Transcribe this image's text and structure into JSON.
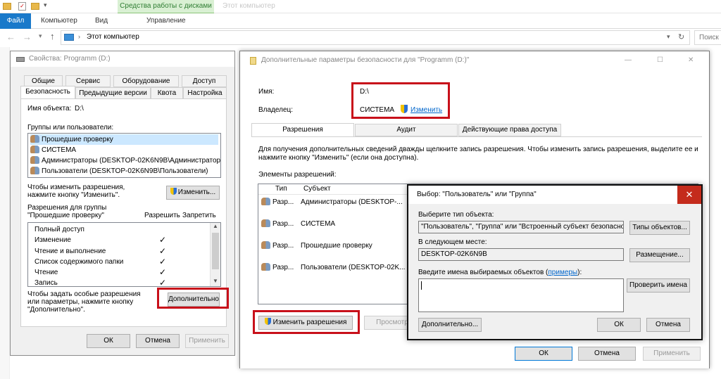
{
  "ribbon": {
    "tabs": [
      "Файл",
      "Компьютер",
      "Вид"
    ],
    "context_group": "Средства работы с дисками",
    "context_tab": "Управление",
    "faded_title": "Этот компьютер"
  },
  "address": {
    "path": "Этот компьютер",
    "search_placeholder": "Поиск"
  },
  "props": {
    "title": "Свойства: Programm (D:)",
    "tabs_row1": [
      "Общие",
      "Сервис",
      "Оборудование",
      "Доступ"
    ],
    "tabs_row2": [
      "Безопасность",
      "Предыдущие версии",
      "Квота",
      "Настройка"
    ],
    "object_label": "Имя объекта:",
    "object_value": "D:\\",
    "groups_label": "Группы или пользователи:",
    "groups": [
      "Прошедшие проверку",
      "СИСТЕМА",
      "Администраторы (DESKTOP-02K6N9B\\Администраторы)",
      "Пользователи (DESKTOP-02K6N9B\\Пользователи)"
    ],
    "change_hint": "Чтобы изменить разрешения, нажмите кнопку \"Изменить\".",
    "change_button": "Изменить...",
    "perms_label_1": "Разрешения для группы",
    "perms_label_2": "\"Прошедшие проверку\"",
    "allow_header": "Разрешить",
    "deny_header": "Запретить",
    "perms": [
      {
        "name": "Полный доступ",
        "allow": ""
      },
      {
        "name": "Изменение",
        "allow": "✓"
      },
      {
        "name": "Чтение и выполнение",
        "allow": "✓"
      },
      {
        "name": "Список содержимого папки",
        "allow": "✓"
      },
      {
        "name": "Чтение",
        "allow": "✓"
      },
      {
        "name": "Запись",
        "allow": "✓"
      }
    ],
    "advanced_hint": "Чтобы задать особые разрешения или параметры, нажмите кнопку \"Дополнительно\".",
    "advanced_button": "Дополнительно",
    "ok": "ОК",
    "cancel": "Отмена",
    "apply": "Применить"
  },
  "adv": {
    "title": "Дополнительные параметры безопасности для \"Programm (D:)\"",
    "name_label": "Имя:",
    "name_value": "D:\\",
    "owner_label": "Владелец:",
    "owner_value": "СИСТЕМА",
    "owner_change": "Изменить",
    "tabs": [
      "Разрешения",
      "Аудит",
      "Действующие права доступа"
    ],
    "info": "Для получения дополнительных сведений дважды щелкните запись разрешения. Чтобы изменить запись разрешения, выделите ее и нажмите кнопку \"Изменить\" (если она доступна).",
    "entries_label": "Элементы разрешений:",
    "col_type": "Тип",
    "col_subject": "Субъект",
    "rows": [
      {
        "type": "Разр...",
        "subject": "Администраторы (DESKTOP-..."
      },
      {
        "type": "Разр...",
        "subject": "СИСТЕМА"
      },
      {
        "type": "Разр...",
        "subject": "Прошедшие проверку"
      },
      {
        "type": "Разр...",
        "subject": "Пользователи (DESKTOP-02K..."
      }
    ],
    "change_perms": "Изменить разрешения",
    "view": "Просмотр",
    "ok": "ОК",
    "cancel": "Отмена",
    "apply": "Применить"
  },
  "select": {
    "title": "Выбор: \"Пользователь\" или \"Группа\"",
    "type_label": "Выберите тип объекта:",
    "type_value": "\"Пользователь\", \"Группа\" или \"Встроенный субъект безопаснос",
    "types_button": "Типы объектов...",
    "location_label": "В следующем месте:",
    "location_value": "DESKTOP-02K6N9B",
    "location_button": "Размещение...",
    "names_label_pre": "Введите имена выбираемых объектов (",
    "names_label_link": "примеры",
    "names_label_post": "):",
    "check_button": "Проверить имена",
    "advanced_button": "Дополнительно...",
    "ok": "ОК",
    "cancel": "Отмена"
  },
  "colors": {
    "accent": "#0078d7",
    "highlight_box": "#c8101a",
    "context_green": "#2e7d32"
  }
}
